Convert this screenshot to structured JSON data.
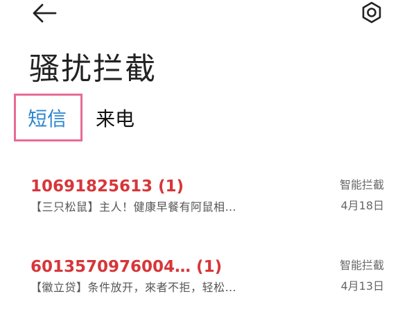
{
  "header": {
    "back_icon": "arrow-left-icon",
    "settings_icon": "gear-icon"
  },
  "page": {
    "title": "骚扰拦截"
  },
  "tabs": [
    {
      "label": "短信",
      "selected": true
    },
    {
      "label": "来电",
      "selected": false
    }
  ],
  "colors": {
    "accent": "#2b84cf",
    "sender_red": "#d6363a",
    "highlight": "#e86b94"
  },
  "messages": [
    {
      "sender": "10691825613 (1)",
      "preview": "【三只松鼠】主人！健康早餐有阿鼠相…",
      "tag": "智能拦截",
      "date": "4月18日"
    },
    {
      "sender": "6013570976004… (1)",
      "preview": "【徽立贷】条件放开，來者不拒，轻松…",
      "tag": "智能拦截",
      "date": "4月13日"
    }
  ]
}
